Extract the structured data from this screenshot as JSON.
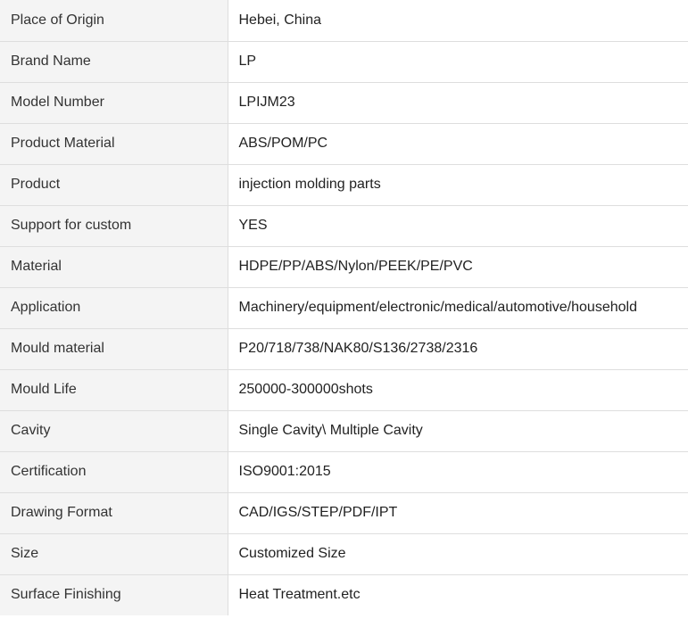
{
  "specs": {
    "rows": [
      {
        "label": "Place of Origin",
        "value": "Hebei, China"
      },
      {
        "label": "Brand Name",
        "value": "LP"
      },
      {
        "label": "Model Number",
        "value": "LPIJM23"
      },
      {
        "label": "Product Material",
        "value": "ABS/POM/PC"
      },
      {
        "label": "Product",
        "value": "injection molding parts"
      },
      {
        "label": "Support for custom",
        "value": "YES"
      },
      {
        "label": "Material",
        "value": "HDPE/PP/ABS/Nylon/PEEK/PE/PVC"
      },
      {
        "label": "Application",
        "value": "Machinery/equipment/electronic/medical/automotive/household"
      },
      {
        "label": "Mould material",
        "value": "P20/718/738/NAK80/S136/2738/2316"
      },
      {
        "label": "Mould Life",
        "value": "250000-300000shots"
      },
      {
        "label": "Cavity",
        "value": "Single Cavity\\ Multiple Cavity"
      },
      {
        "label": "Certification",
        "value": "ISO9001:2015"
      },
      {
        "label": "Drawing Format",
        "value": "CAD/IGS/STEP/PDF/IPT"
      },
      {
        "label": "Size",
        "value": "Customized Size"
      },
      {
        "label": "Surface Finishing",
        "value": "Heat Treatment.etc"
      }
    ]
  }
}
